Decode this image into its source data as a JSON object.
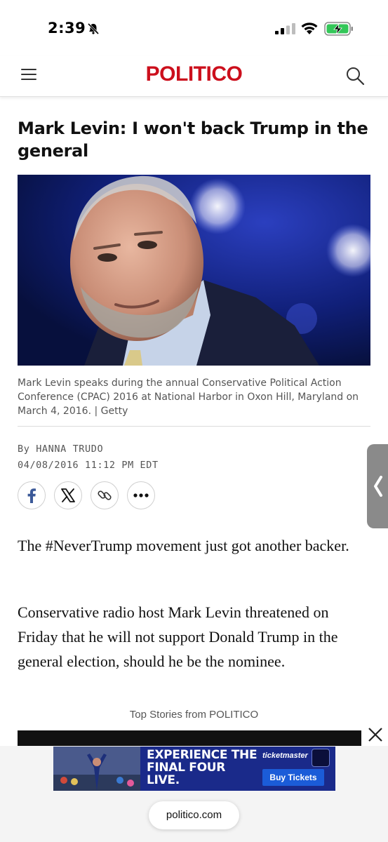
{
  "status_bar": {
    "time": "2:39",
    "icons": [
      "bell-slash-icon",
      "cellular-signal-icon",
      "wifi-icon",
      "battery-charging-icon"
    ]
  },
  "header": {
    "logo": "POLITICO",
    "brand_color": "#cc0f1c",
    "icons": [
      "hamburger-menu-icon",
      "search-icon"
    ]
  },
  "article": {
    "headline": "Mark Levin: I won't back Trump in the general",
    "image_caption": "Mark Levin speaks during the annual Conservative Political Action Conference (CPAC) 2016 at National Harbor in Oxon Hill, Maryland on March 4, 2016. | Getty",
    "byline_prefix": "By",
    "author": "HANNA TRUDO",
    "dateline": "04/08/2016 11:12 PM EDT",
    "share_buttons": [
      "facebook-icon",
      "x-icon",
      "link-icon",
      "more-icon"
    ],
    "paragraphs": [
      "The #NeverTrump movement just got another backer.",
      "Conservative radio host Mark Levin threatened on Friday that he will not support Donald Trump in the general election, should he be the nominee."
    ]
  },
  "top_stories": {
    "label": "Top Stories from POLITICO"
  },
  "ad": {
    "headline": "EXPERIENCE THE FINAL FOUR LIVE.",
    "brand": "ticketmaster",
    "cta": "Buy Tickets",
    "bg_color": "#1a2a8a",
    "cta_color": "#1b5cd8"
  },
  "browser": {
    "url": "politico.com"
  }
}
